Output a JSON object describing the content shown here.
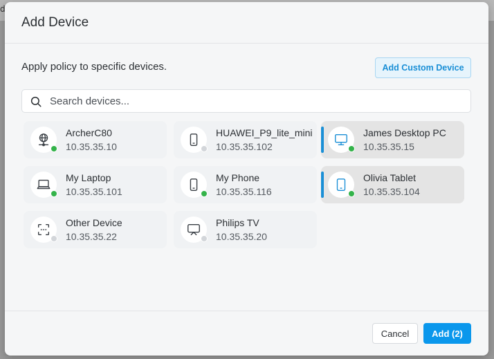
{
  "backdrop": {
    "glyph": "d"
  },
  "dialog": {
    "title": "Add Device",
    "subtitle": "Apply policy to specific devices.",
    "custom_button_label": "Add Custom Device",
    "search": {
      "placeholder": "Search devices...",
      "value": ""
    },
    "devices": [
      {
        "name": "ArcherC80",
        "ip": "10.35.35.10",
        "icon": "router-globe-icon",
        "online": true,
        "selected": false
      },
      {
        "name": "HUAWEI_P9_lite_mini",
        "ip": "10.35.35.102",
        "icon": "phone-icon",
        "online": false,
        "selected": false
      },
      {
        "name": "James Desktop PC",
        "ip": "10.35.35.15",
        "icon": "monitor-icon",
        "online": true,
        "selected": true
      },
      {
        "name": "My Laptop",
        "ip": "10.35.35.101",
        "icon": "laptop-icon",
        "online": true,
        "selected": false
      },
      {
        "name": "My Phone",
        "ip": "10.35.35.116",
        "icon": "phone-icon",
        "online": true,
        "selected": false
      },
      {
        "name": "Olivia Tablet",
        "ip": "10.35.35.104",
        "icon": "tablet-icon",
        "online": true,
        "selected": true
      },
      {
        "name": "Other Device",
        "ip": "10.35.35.22",
        "icon": "other-device-icon",
        "online": false,
        "selected": false
      },
      {
        "name": "Philips TV",
        "ip": "10.35.35.20",
        "icon": "tv-icon",
        "online": false,
        "selected": false
      }
    ],
    "footer": {
      "cancel_label": "Cancel",
      "add_label": "Add (2)"
    }
  },
  "colors": {
    "accent": "#1a8fd6",
    "primary_button": "#0a97ec",
    "online": "#34b34a",
    "offline": "#d3d6da",
    "selected_bg": "#e4e4e4"
  }
}
